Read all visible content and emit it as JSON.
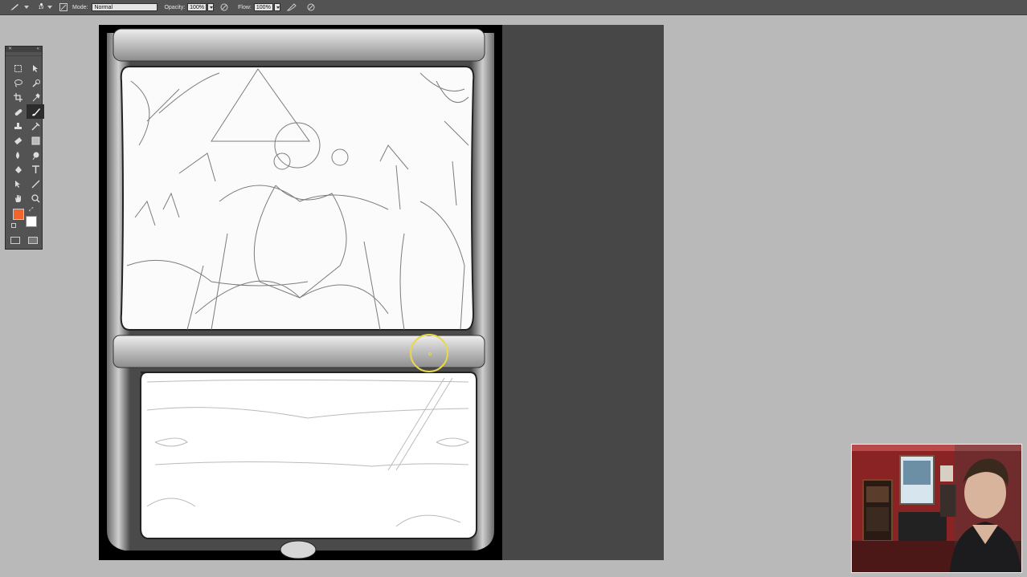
{
  "options_bar": {
    "brush_size": "19",
    "mode_label": "Mode:",
    "mode_value": "Normal",
    "opacity_label": "Opacity:",
    "opacity_value": "100%",
    "flow_label": "Flow:",
    "flow_value": "100%"
  },
  "toolbox": {
    "tools": [
      "marquee-icon",
      "move-icon",
      "lasso-icon",
      "quick-select-icon",
      "crop-icon",
      "eyedropper-icon",
      "spot-heal-icon",
      "brush-icon",
      "stamp-icon",
      "history-brush-icon",
      "eraser-icon",
      "gradient-icon",
      "blur-icon",
      "dodge-icon",
      "pen-icon",
      "type-icon",
      "path-select-icon",
      "line-icon",
      "hand-icon",
      "zoom-icon"
    ],
    "active_tool": "brush-icon",
    "foreground_color": "#f2642a",
    "background_color": "#ffffff"
  },
  "canvas": {
    "document_bg": "#000000",
    "pasteboard_bg": "#474747"
  },
  "cursor_color": "#e6d94a"
}
